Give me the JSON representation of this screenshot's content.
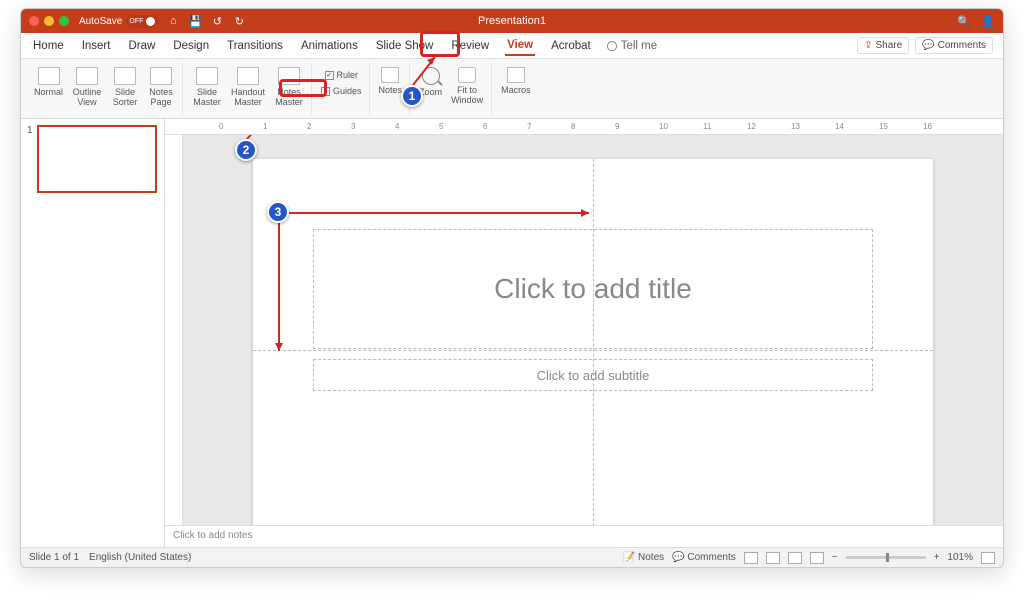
{
  "titlebar": {
    "autosave_label": "AutoSave",
    "autosave_state": "OFF",
    "doc_title": "Presentation1"
  },
  "tabs": {
    "items": [
      "Home",
      "Insert",
      "Draw",
      "Design",
      "Transitions",
      "Animations",
      "Slide Show",
      "Review",
      "View",
      "Acrobat"
    ],
    "active": "View",
    "tell_me": "Tell me",
    "share": "Share",
    "comments": "Comments"
  },
  "ribbon": {
    "views": [
      "Normal",
      "Outline View",
      "Slide Sorter",
      "Notes Page"
    ],
    "masters": [
      "Slide Master",
      "Handout Master",
      "Notes Master"
    ],
    "show": {
      "ruler": "Ruler",
      "guides": "Guides",
      "notes": "Notes"
    },
    "zoom": {
      "zoom": "Zoom",
      "fit": "Fit to Window"
    },
    "macros": "Macros"
  },
  "ruler": {
    "h_ticks": [
      "0",
      "1",
      "2",
      "3",
      "4",
      "5",
      "6",
      "7",
      "8",
      "9",
      "10",
      "11",
      "12",
      "13",
      "14",
      "15",
      "16"
    ]
  },
  "thumbs": {
    "slide_number": "1"
  },
  "slide": {
    "title_placeholder": "Click to add title",
    "subtitle_placeholder": "Click to add subtitle"
  },
  "notes_pane": "Click to add notes",
  "status": {
    "slide_info": "Slide 1 of 1",
    "language": "English (United States)",
    "notes_btn": "Notes",
    "comments_btn": "Comments",
    "zoom_pct": "101%"
  },
  "annotations": {
    "c1": "1",
    "c2": "2",
    "c3": "3"
  }
}
